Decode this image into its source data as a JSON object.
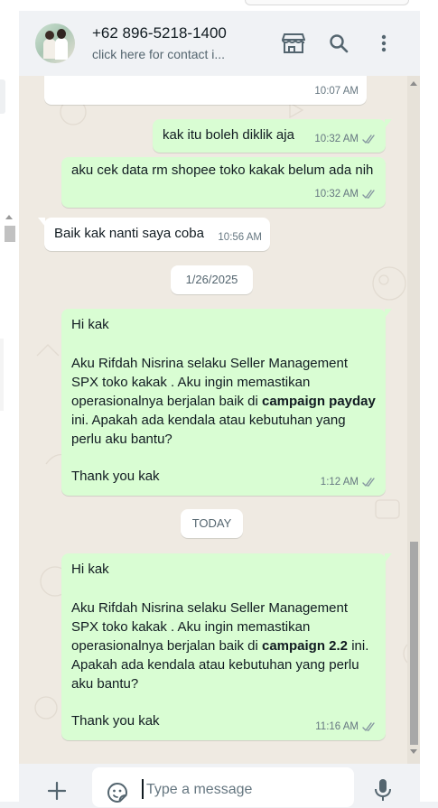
{
  "header": {
    "contact_name": "+62 896-5218-1400",
    "contact_subtitle": "click here for contact i..."
  },
  "icons": {
    "store": "store-icon",
    "search": "search-icon",
    "menu": "more-vertical-icon",
    "attach": "plus-icon",
    "emoji": "sticker-emoji-icon",
    "mic": "microphone-icon",
    "read_receipt": "double-check-icon"
  },
  "colors": {
    "outgoing_bubble": "#d9fdd3",
    "incoming_bubble": "#ffffff",
    "chat_background": "#efeae2",
    "header_background": "#f0f2f5",
    "read_ticks": "#8696a0"
  },
  "messages": [
    {
      "direction": "in",
      "text": "",
      "time": "10:07 AM"
    },
    {
      "direction": "out",
      "text": "kak itu boleh diklik aja",
      "time": "10:32 AM",
      "status": "read"
    },
    {
      "direction": "out",
      "text": "aku cek data rm shopee toko kakak belum ada nih",
      "time": "10:32 AM",
      "status": "read"
    },
    {
      "direction": "in",
      "text": "Baik kak nanti saya coba",
      "time": "10:56 AM"
    },
    {
      "direction": "date",
      "text": "1/26/2025"
    },
    {
      "direction": "out",
      "greeting": "Hi kak",
      "body_before": "Aku Rifdah Nisrina selaku Seller Management SPX toko kakak . Aku ingin memastikan operasionalnya berjalan baik di ",
      "bold": "campaign payday",
      "body_after": " ini. Apakah ada kendala atau kebutuhan yang perlu aku bantu?",
      "closing": "Thank you kak",
      "time": "1:12 AM",
      "status": "read"
    },
    {
      "direction": "date",
      "text": "TODAY"
    },
    {
      "direction": "out",
      "greeting": "Hi kak",
      "body_before": "Aku Rifdah Nisrina selaku Seller Management SPX toko kakak . Aku ingin memastikan operasionalnya berjalan baik di ",
      "bold": "campaign 2.2",
      "body_after": " ini. Apakah ada kendala atau kebutuhan yang perlu aku bantu?",
      "closing": "Thank you kak",
      "time": "11:16 AM",
      "status": "read"
    }
  ],
  "composer": {
    "placeholder": "Type a message",
    "value": ""
  }
}
